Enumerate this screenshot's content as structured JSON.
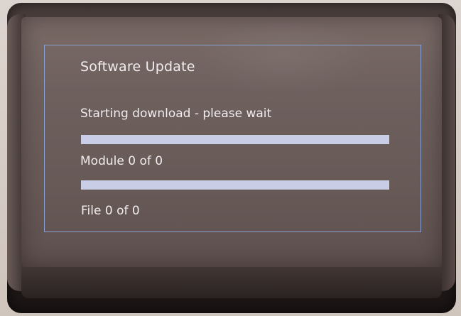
{
  "screen": {
    "title": "Software Update",
    "status": "Starting download - please wait",
    "module_progress": {
      "label": "Module 0 of 0",
      "fraction": 0
    },
    "file_progress": {
      "label": "File 0 of 0",
      "fraction": 0
    },
    "colors": {
      "frame_border": "#8aa0d0",
      "bar_track": "#c9cde6",
      "text": "#f1ecee"
    }
  }
}
